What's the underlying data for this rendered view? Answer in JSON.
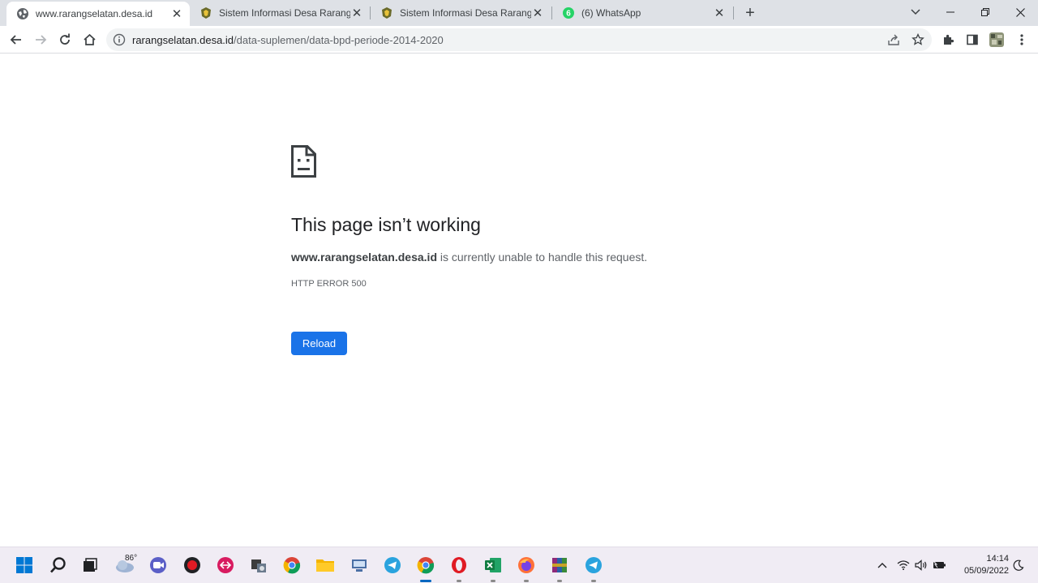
{
  "browser": {
    "tabs": [
      {
        "title": "www.rarangselatan.desa.id",
        "icon": "globe-icon",
        "active": true
      },
      {
        "title": "Sistem Informasi Desa Rarang Se",
        "icon": "desa-logo-icon",
        "active": false
      },
      {
        "title": "Sistem Informasi Desa Rarang Se",
        "icon": "desa-logo-icon",
        "active": false
      },
      {
        "title": "(6) WhatsApp",
        "icon": "whatsapp-icon",
        "badge": "6",
        "active": false
      }
    ],
    "address": {
      "host": "rarangselatan.desa.id",
      "path": "/data-suplemen/data-bpd-periode-2014-2020"
    }
  },
  "error_page": {
    "title": "This page isn’t working",
    "host": "www.rarangselatan.desa.id",
    "message": " is currently unable to handle this request.",
    "code": "HTTP ERROR 500",
    "reload_label": "Reload"
  },
  "taskbar": {
    "weather_temp": "86°",
    "time": "14:14",
    "date": "05/09/2022"
  },
  "colors": {
    "accent": "#1a73e8",
    "tabstrip": "#dee1e6",
    "taskbar": "#f0ecf4"
  }
}
